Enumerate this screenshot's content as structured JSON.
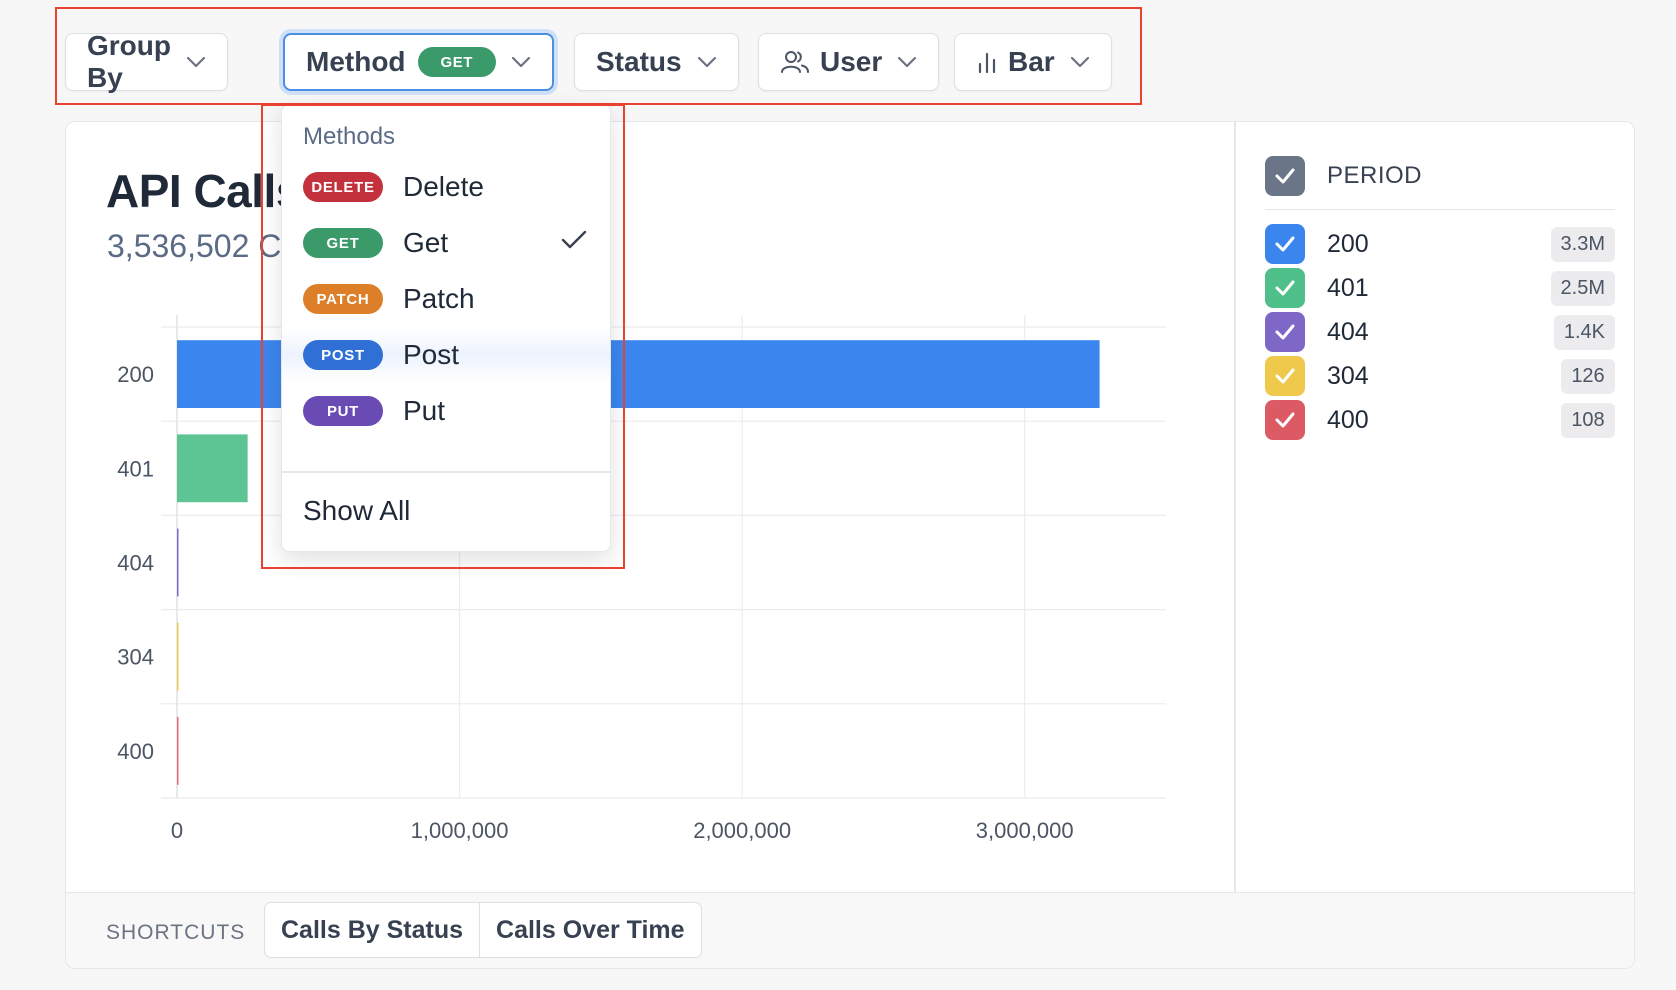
{
  "toolbar": {
    "group_by_label": "Group By",
    "method_label": "Method",
    "method_badge": "GET",
    "status_label": "Status",
    "user_label": "User",
    "chart_type_label": "Bar"
  },
  "chart_header": {
    "title": "API Calls",
    "subtitle": "3,536,502 Calls"
  },
  "chart_data": {
    "type": "bar",
    "orientation": "horizontal",
    "categories": [
      "200",
      "401",
      "404",
      "304",
      "400"
    ],
    "values": [
      3265000,
      250000,
      1400,
      126,
      108
    ],
    "colors": [
      "#3b86ee",
      "#5cc593",
      "#7f67c8",
      "#efc94c",
      "#e06c74"
    ],
    "xlim": [
      0,
      3500000
    ],
    "xticks": [
      0,
      1000000,
      2000000,
      3000000
    ],
    "xtick_labels": [
      "0",
      "1,000,000",
      "2,000,000",
      "3,000,000"
    ],
    "grid": true
  },
  "legend": {
    "header_label": "PERIOD",
    "header_color": "#6b7588",
    "items": [
      {
        "name": "200",
        "value": "3.3M",
        "color": "#3b86ee"
      },
      {
        "name": "401",
        "value": "2.5M",
        "color": "#4fc089"
      },
      {
        "name": "404",
        "value": "1.4K",
        "color": "#7f67c8"
      },
      {
        "name": "304",
        "value": "126",
        "color": "#efc94c"
      },
      {
        "name": "400",
        "value": "108",
        "color": "#dc5a64"
      }
    ]
  },
  "shortcuts": {
    "label": "SHORTCUTS",
    "buttons": [
      "Calls By Status",
      "Calls Over Time"
    ]
  },
  "dropdown": {
    "header": "Methods",
    "items": [
      {
        "badge": "DELETE",
        "label": "Delete",
        "color": "#c2313c",
        "selected": false
      },
      {
        "badge": "GET",
        "label": "Get",
        "color": "#3a9a6a",
        "selected": true
      },
      {
        "badge": "PATCH",
        "label": "Patch",
        "color": "#dc7f28",
        "selected": false
      },
      {
        "badge": "POST",
        "label": "Post",
        "color": "#2f6fd6",
        "selected": false
      },
      {
        "badge": "PUT",
        "label": "Put",
        "color": "#6a4bb4",
        "selected": false
      }
    ],
    "show_all_label": "Show All"
  },
  "icons": {
    "chevron": "chevron-down-icon",
    "user": "users-icon",
    "bar": "bar-chart-icon",
    "check": "check-icon"
  }
}
